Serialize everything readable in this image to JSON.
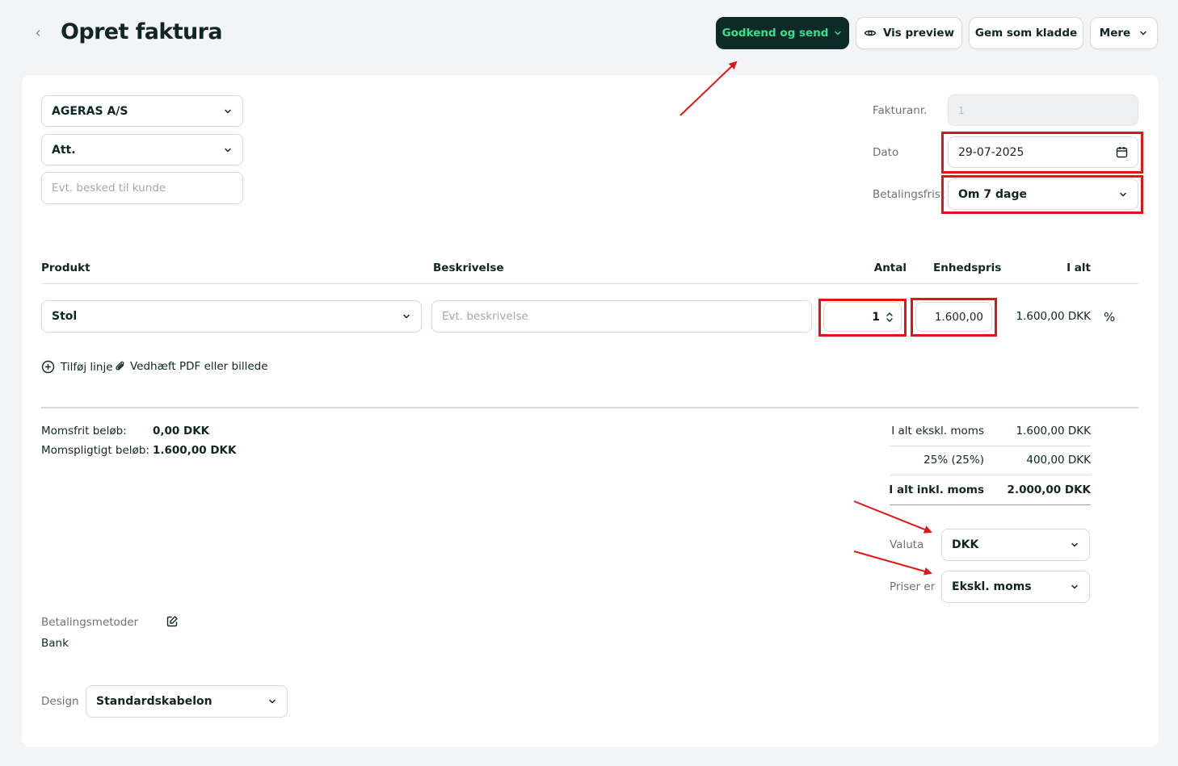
{
  "header": {
    "back_icon": "chevron-left-icon",
    "title": "Opret faktura",
    "approve_send_label": "Godkend og send",
    "preview_label": "Vis preview",
    "save_draft_label": "Gem som kladde",
    "more_label": "Mere"
  },
  "customer": {
    "selected": "AGERAS A/S",
    "att": "Att.",
    "message_placeholder": "Evt. besked til kunde"
  },
  "meta": {
    "invoice_no_label": "Fakturanr.",
    "invoice_no_value": "1",
    "date_label": "Dato",
    "date_value": "29-07-2025",
    "payment_terms_label": "Betalingsfrist",
    "payment_terms_value": "Om 7 dage"
  },
  "lines": {
    "columns": [
      "Produkt",
      "Beskrivelse",
      "Antal",
      "Enhedspris",
      "I alt"
    ],
    "rows": [
      {
        "product": "Stol",
        "description_placeholder": "Evt. beskrivelse",
        "quantity": "1",
        "unit_price": "1.600,00",
        "total": "1.600,00 DKK",
        "discount_symbol": "%"
      }
    ],
    "add_line_label": "Tilføj linje",
    "attach_label": "Vedhæft PDF eller billede"
  },
  "vat_summary": {
    "exempt_label": "Momsfrit beløb:",
    "exempt_value": "0,00 DKK",
    "taxable_label": "Momspligtigt beløb:",
    "taxable_value": "1.600,00 DKK"
  },
  "totals": {
    "excl_label": "I alt ekskl. moms",
    "excl_value": "1.600,00 DKK",
    "vat_label": "25% (25%)",
    "vat_value": "400,00 DKK",
    "incl_label": "I alt inkl. moms",
    "incl_value": "2.000,00 DKK"
  },
  "currency": {
    "label": "Valuta",
    "value": "DKK"
  },
  "prices": {
    "label": "Priser er",
    "value": "Ekskl. moms"
  },
  "payment_methods": {
    "label": "Betalingsmetoder",
    "value": "Bank"
  },
  "design": {
    "label": "Design",
    "value": "Standardskabelon"
  },
  "colors": {
    "primary_bg": "#0b2a28",
    "primary_text": "#35e18a",
    "highlight": "#e01616",
    "page_bg": "#f3f4f6"
  }
}
